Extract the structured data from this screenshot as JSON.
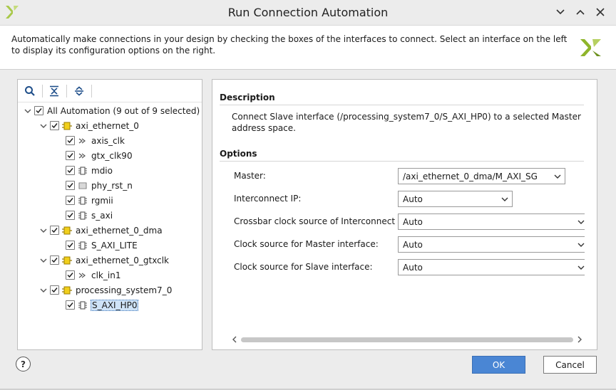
{
  "window": {
    "title": "Run Connection Automation"
  },
  "description_bar": {
    "text": "Automatically make connections in your design by checking the boxes of the interfaces to connect. Select an interface on the left to display its configuration options on the right."
  },
  "tree": {
    "root": {
      "label": "All Automation (9 out of 9 selected)",
      "checked": true
    },
    "nodes": [
      {
        "label": "axi_ethernet_0",
        "checked": true,
        "icon": "ip-block-icon"
      },
      {
        "label": "axis_clk",
        "checked": true,
        "icon": "clock-port-icon"
      },
      {
        "label": "gtx_clk90",
        "checked": true,
        "icon": "clock-port-icon"
      },
      {
        "label": "mdio",
        "checked": true,
        "icon": "bus-interface-icon"
      },
      {
        "label": "phy_rst_n",
        "checked": true,
        "icon": "reset-port-icon"
      },
      {
        "label": "rgmii",
        "checked": true,
        "icon": "bus-interface-icon"
      },
      {
        "label": "s_axi",
        "checked": true,
        "icon": "bus-interface-icon"
      },
      {
        "label": "axi_ethernet_0_dma",
        "checked": true,
        "icon": "ip-block-icon"
      },
      {
        "label": "S_AXI_LITE",
        "checked": true,
        "icon": "bus-interface-icon"
      },
      {
        "label": "axi_ethernet_0_gtxclk",
        "checked": true,
        "icon": "ip-block-icon"
      },
      {
        "label": "clk_in1",
        "checked": true,
        "icon": "clock-port-icon"
      },
      {
        "label": "processing_system7_0",
        "checked": true,
        "icon": "ip-block-icon"
      },
      {
        "label": "S_AXI_HP0",
        "checked": true,
        "icon": "bus-interface-icon",
        "selected": true
      }
    ]
  },
  "details": {
    "description_heading": "Description",
    "description_text": "Connect Slave interface (/processing_system7_0/S_AXI_HP0) to a selected Master address space.",
    "options_heading": "Options",
    "options": [
      {
        "label": "Master:",
        "value": "/axi_ethernet_0_dma/M_AXI_SG"
      },
      {
        "label": "Interconnect IP:",
        "value": "Auto"
      },
      {
        "label": "Crossbar clock source of Interconnect IP:",
        "value": "Auto"
      },
      {
        "label": "Clock source for Master interface:",
        "value": "Auto"
      },
      {
        "label": "Clock source for Slave interface:",
        "value": "Auto"
      }
    ]
  },
  "footer": {
    "help_label": "?",
    "ok_label": "OK",
    "cancel_label": "Cancel"
  },
  "colors": {
    "accent": "#4a86d4",
    "xilinx_logo": "#9bbf35",
    "ip_block": "#e8c200"
  }
}
